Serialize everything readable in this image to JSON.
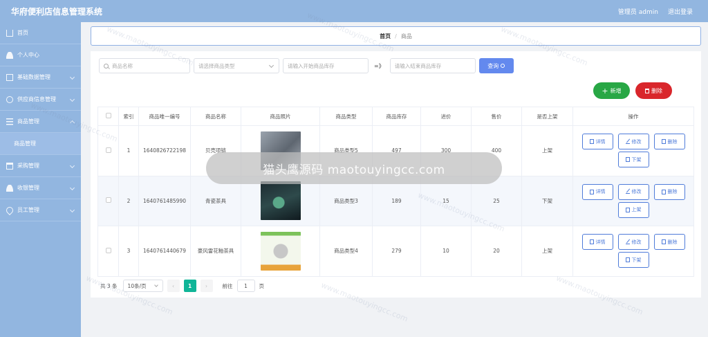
{
  "header": {
    "app_title": "华府便利店信息管理系统",
    "admin_label": "管理员 admin",
    "logout_label": "退出登录"
  },
  "sidebar": {
    "items": [
      {
        "label": "首页",
        "icon": "home-icon"
      },
      {
        "label": "个人中心",
        "icon": "user-icon"
      },
      {
        "label": "基础数据管理",
        "icon": "grid-icon"
      },
      {
        "label": "供应商信息管理",
        "icon": "circle-icon"
      },
      {
        "label": "商品管理",
        "icon": "list-icon"
      },
      {
        "label": "商品管理",
        "icon": ""
      },
      {
        "label": "采购管理",
        "icon": "cart-icon"
      },
      {
        "label": "收银管理",
        "icon": "cash-icon"
      },
      {
        "label": "员工管理",
        "icon": "pin-icon"
      }
    ]
  },
  "breadcrumb": {
    "home": "首页",
    "separator": "/",
    "current": "商品"
  },
  "search": {
    "name_placeholder": "商品名称",
    "type_placeholder": "请选择商品类型",
    "stock_start_placeholder": "请输入开始商品库存",
    "range_sep": "=》",
    "stock_end_placeholder": "请输入结束商品库存",
    "query_label": "查询"
  },
  "actions": {
    "add_label": "新增",
    "delete_label": "删除"
  },
  "table": {
    "headers": [
      "索引",
      "商品唯一编号",
      "商品名称",
      "商品照片",
      "商品类型",
      "商品库存",
      "进价",
      "售价",
      "是否上架",
      "操作"
    ],
    "rows": [
      {
        "index": "1",
        "code": "1640826722198",
        "name": "贝壳项链",
        "type": "商品类型5",
        "stock": "497",
        "cost": "300",
        "price": "400",
        "on_shelf": "上架",
        "toggle_label": "下架"
      },
      {
        "index": "2",
        "code": "1640761485990",
        "name": "青瓷茶具",
        "type": "商品类型3",
        "stock": "189",
        "cost": "15",
        "price": "25",
        "on_shelf": "下架",
        "toggle_label": "上架"
      },
      {
        "index": "3",
        "code": "1640761440679",
        "name": "豪风雷花釉茶具",
        "type": "商品类型4",
        "stock": "279",
        "cost": "10",
        "price": "20",
        "on_shelf": "上架",
        "toggle_label": "下架"
      }
    ],
    "op_labels": {
      "detail": "详情",
      "edit": "修改",
      "delete": "删除"
    }
  },
  "pagination": {
    "total": "共 3 条",
    "page_size": "10条/页",
    "prev": "‹",
    "current": "1",
    "next": "›",
    "goto_label": "前往",
    "goto_value": "1",
    "page_unit": "页"
  },
  "watermark": {
    "text": "猫头鹰源码 maotouyingcc.com",
    "tile": "www.maotouyingcc.com"
  },
  "colors": {
    "header_bg": "#92b6e0",
    "query_btn": "#6389ee",
    "add_btn": "#28a745",
    "delete_btn": "#d9262b",
    "page_active": "#10b598",
    "op_btn": "#4e7bd9"
  }
}
